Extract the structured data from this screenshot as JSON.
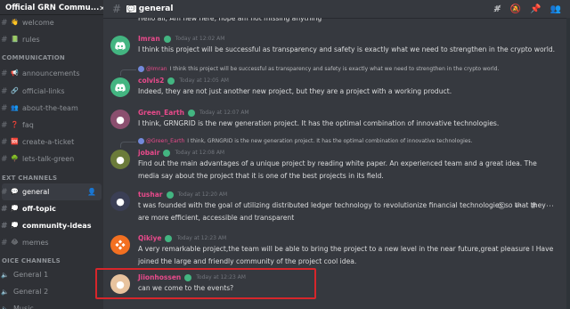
{
  "server": {
    "name": "Official GRN Commu..."
  },
  "sidebar": {
    "items": [
      {
        "type": "channel",
        "label": "welcome",
        "emoji": "👋"
      },
      {
        "type": "channel",
        "label": "rules",
        "emoji": "📗"
      },
      {
        "type": "category",
        "label": "COMMUNICATION"
      },
      {
        "type": "channel",
        "label": "announcements",
        "emoji": "📢"
      },
      {
        "type": "channel",
        "label": "official-links",
        "emoji": "🔗"
      },
      {
        "type": "channel",
        "label": "about-the-team",
        "emoji": "👥"
      },
      {
        "type": "channel",
        "label": "faq",
        "emoji": "❓"
      },
      {
        "type": "channel",
        "label": "create-a-ticket",
        "emoji": "🆘"
      },
      {
        "type": "channel",
        "label": "lets-talk-green",
        "emoji": "🌳"
      },
      {
        "type": "category",
        "label": "EXT CHANNELS"
      },
      {
        "type": "channel",
        "label": "general",
        "emoji": "💬",
        "active": true
      },
      {
        "type": "channel",
        "label": "off-topic",
        "emoji": "💭",
        "unread": true
      },
      {
        "type": "channel",
        "label": "community-ideas",
        "emoji": "💭",
        "unread": true
      },
      {
        "type": "channel",
        "label": "memes",
        "emoji": "😂"
      },
      {
        "type": "category",
        "label": "OICE CHANNELS"
      },
      {
        "type": "voice",
        "label": "General 1"
      },
      {
        "type": "voice",
        "label": "General 2"
      },
      {
        "type": "voice",
        "label": "Music"
      }
    ]
  },
  "header": {
    "channel": "general",
    "emoji": "💬"
  },
  "messages": [
    {
      "text": "Hello all, Am new here, hope am not missing anything"
    },
    {
      "name": "Imran",
      "name_color": "#e84a8b",
      "ts": "Today at 12:02 AM",
      "avatar": "discord",
      "avatar_color": "#43b581",
      "text": "I think this project will be successful as transparency and safety is exactly what we need to strengthen in the crypto world."
    },
    {
      "reply_name": "@Imran",
      "reply_text": "I think this project will be successful as transparency and safety is exactly what we need to strengthen in the crypto world.",
      "name": "colvis2",
      "name_color": "#e84a8b",
      "ts": "Today at 12:05 AM",
      "avatar": "discord",
      "avatar_color": "#43b581",
      "text": "Indeed, they are not just another new project, but they are a project with a working product."
    },
    {
      "name": "Green_Earth",
      "name_color": "#e84a8b",
      "ts": "Today at 12:07 AM",
      "avatar": "photo",
      "avatar_color": "#8b4f6f",
      "text": "I think, GRNGRID is the new generation project. It has the optimal combination of innovative technologies."
    },
    {
      "reply_name": "@Green_Earth",
      "reply_text": "I think, GRNGRID is the new generation project. It has the optimal combination of innovative technologies.",
      "name": "jobair",
      "name_color": "#e84a8b",
      "ts": "Today at 12:08 AM",
      "avatar": "photo",
      "avatar_color": "#6b7b3a",
      "text": "Find out the main advantages of a unique project by reading white paper. An experienced team and a great idea. The media say about the project that it is one of the best projects in its field."
    },
    {
      "name": "tushar",
      "name_color": "#e84a8b",
      "ts": "Today at 12:20 AM",
      "avatar": "photo",
      "avatar_color": "#3b3f55",
      "text": "t was founded with the goal of utilizing distributed ledger technology to revolutionize financial technologies so that they are more efficient, accessible and transparent"
    },
    {
      "name": "Qikiye",
      "name_color": "#e84a8b",
      "ts": "Today at 12:23 AM",
      "avatar": "logo",
      "avatar_color": "#f37021",
      "text": "A very remarkable project,the team will be able to bring the project to a new level in the near future,great pleasure I Have joined the large and friendly community of the project cool idea."
    },
    {
      "name": "Jiionhossen",
      "name_color": "#e84a8b",
      "ts": "Today at 12:23 AM",
      "avatar": "photo",
      "avatar_color": "#e8c39e",
      "text": "can we come to the events?"
    }
  ]
}
